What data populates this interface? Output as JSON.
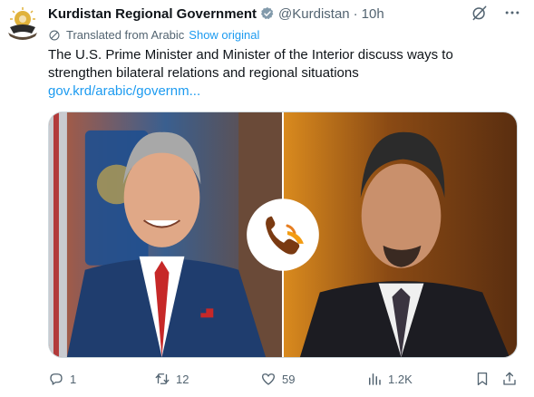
{
  "post": {
    "author_name": "Kurdistan Regional Government",
    "handle": "@Kurdistan",
    "separator": "·",
    "time": "10h",
    "translated_note": "Translated from Arabic",
    "show_original": "Show original",
    "text": "The U.S. Prime Minister and Minister of the Interior discuss ways to strengthen bilateral relations and regional situations",
    "link": "gov.krd/arabic/governm..."
  },
  "icons": {
    "avatar": "krg-emblem-icon",
    "verified": "verified-badge-icon",
    "grok": "grok-icon",
    "more": "more-icon",
    "translate": "translate-icon",
    "reply": "reply-icon",
    "retweet": "retweet-icon",
    "like": "like-icon",
    "views": "views-icon",
    "bookmark": "bookmark-icon",
    "share": "share-icon",
    "phone": "phone-icon"
  },
  "actions": {
    "replies": "1",
    "reposts": "12",
    "likes": "59",
    "views": "1.2K"
  },
  "colors": {
    "text": "#0f1419",
    "secondary": "#536471",
    "link": "#1d9bf0",
    "verified": "#829aab",
    "phone_accent": "#e67e22"
  }
}
